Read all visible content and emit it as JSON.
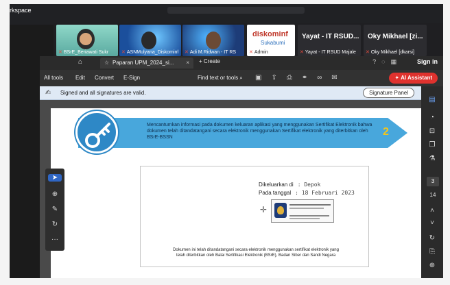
{
  "meeting": {
    "workspace_label": "rkspace",
    "participants": [
      {
        "name": "BSrE_Beriawati Sukr",
        "muted": true
      },
      {
        "name": "ASNMulyana_Diskominf",
        "muted": true
      },
      {
        "name": "Adi M.Ridwan - IT RS",
        "muted": true
      },
      {
        "name": "Admin",
        "muted": true,
        "logo_text": "diskominf",
        "logo_sub": "Sukabumi"
      },
      {
        "name": "Yayat - IT RSUD Majale",
        "display": "Yayat - IT RSUD...",
        "muted": true
      },
      {
        "name": "Oky Mikhael [dkarsi]",
        "display": "Oky Mikhael [zi...",
        "muted": true
      }
    ]
  },
  "acrobat": {
    "tab_title": "Paparan UPM_2024_si...",
    "create_label": "Create",
    "sign_in_label": "Sign in",
    "menu": [
      "All tools",
      "Edit",
      "Convert",
      "E-Sign"
    ],
    "find_label": "Find text or tools",
    "ai_label": "AI Assistant",
    "signature_message": "Signed and all signatures are valid.",
    "signature_panel_label": "Signature Panel",
    "current_page": "3",
    "total_pages": "14"
  },
  "slide": {
    "banner_text": "Mencantumkan informasi pada dokumen keluaran aplikasi yang menggunakan Sertifikat Elektronik bahwa dokumen telah ditandatangani secara elektronik menggunakan Sertifikat elektronik yang diterbitkan oleh BSrE-BSSN",
    "banner_number": "2",
    "issued_at_label": "Dikeluarkan di",
    "issued_at_value": ": Depok",
    "date_label": "Pada tanggal",
    "date_value": ": 18 Februari 2023",
    "footnote": "Dokumen ini telah ditandatangani secara elektronik menggunakan sertifikat elektronik yang telah diterbitkan oleh Balai Sertifikasi Elektronik (BSrE), Badan Siber dan Sandi Negara"
  },
  "colors": {
    "banner": "#48a7dc",
    "ai_button": "#e0322e",
    "signature_bar": "#dfe9f5",
    "banner_number": "#f5c518"
  }
}
